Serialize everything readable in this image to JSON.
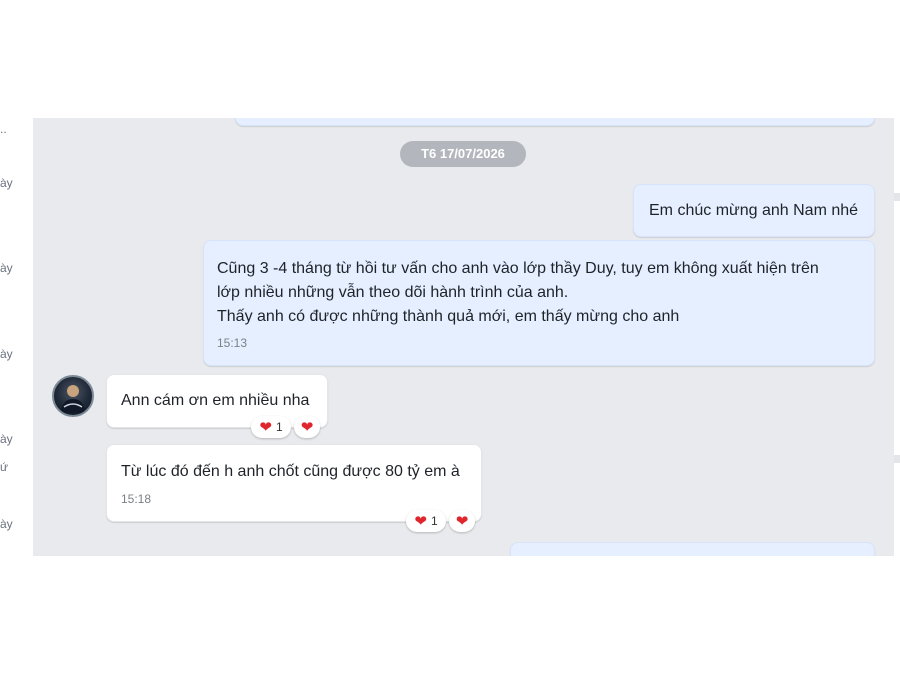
{
  "sidebar": {
    "fragments": [
      "..",
      "ày",
      "ày",
      "ày",
      "ày",
      "ứ",
      "ày"
    ]
  },
  "chat": {
    "date_divider": "T6 17/07/2026",
    "messages": [
      {
        "from": "me",
        "lines": [
          "Em chúc mừng anh Nam nhé"
        ]
      },
      {
        "from": "me",
        "lines": [
          "Cũng 3 -4 tháng từ hồi tư vấn cho anh vào lớp thầy Duy, tuy em không xuất hiện trên",
          "lớp nhiều những vẫn theo dõi hành trình của anh.",
          "Thấy anh có được những thành quả mới, em thấy mừng cho anh"
        ],
        "time": "15:13"
      },
      {
        "from": "other",
        "lines": [
          "Ann cám ơn em nhiều nha"
        ],
        "reaction": {
          "icon": "heart-icon",
          "count": "1"
        }
      },
      {
        "from": "other",
        "lines": [
          "Từ lúc đó đến h anh chốt cũng được 80 tỷ em à"
        ],
        "time": "15:18",
        "reaction": {
          "icon": "heart-icon",
          "count": "1"
        }
      }
    ]
  },
  "colors": {
    "chat_background": "#e9eaed",
    "my_bubble": "#e5efff",
    "their_bubble": "#ffffff",
    "date_pill": "#b3b6bc",
    "heart": "#e0262d"
  }
}
